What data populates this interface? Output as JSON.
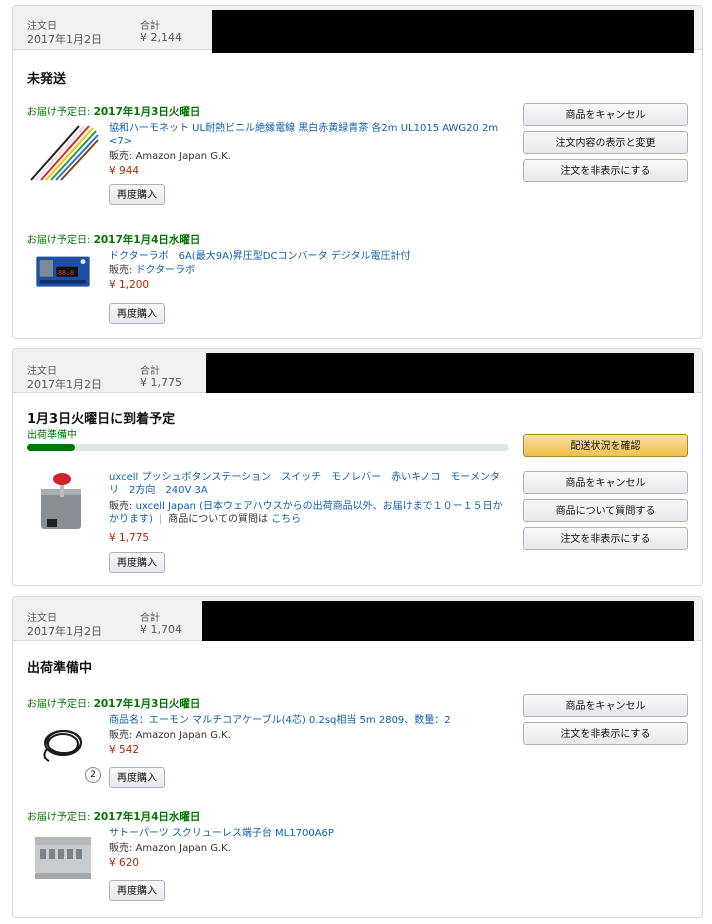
{
  "labels": {
    "order_date": "注文日",
    "total": "合計",
    "rebuy": "再度購入",
    "delivery_prefix": "お届け予定日: ",
    "seller_prefix": "販売: "
  },
  "orders": [
    {
      "date": "2017年1月2日",
      "total": "¥ 2,144",
      "status": "未発送",
      "buttons": [
        "商品をキャンセル",
        "注文内容の表示と変更",
        "注文を非表示にする"
      ],
      "shipments": [
        {
          "delivery_date": "2017年1月3日火曜日",
          "item": {
            "title_line1": "協和ハーモネット UL耐熱ビニル絶縁電線 黒白赤黄緑青茶 各2m UL1015 AWG20 2m",
            "title_line2": "<7>",
            "seller": "Amazon Japan G.K.",
            "price": "¥ 944",
            "image": "colored-wires-image"
          }
        },
        {
          "delivery_date": "2017年1月4日水曜日",
          "item": {
            "title_line1": "ドクターラボ　6A(最大9A)昇圧型DCコンバータ デジタル電圧計付",
            "seller": "ドクターラボ",
            "price": "¥ 1,200",
            "image": "dc-converter-board-image"
          }
        }
      ]
    },
    {
      "date": "2017年1月2日",
      "total": "¥ 1,775",
      "status": "1月3日火曜日に到着予定",
      "sub_status": "出荷準備中",
      "progress": 0.1,
      "primary_button": "配送状況を確認",
      "buttons": [
        "商品をキャンセル",
        "商品について質問する",
        "注文を非表示にする"
      ],
      "item": {
        "title_line1": "uxcell プッシュボタンステーション　スイッチ　モノレバー　赤いキノコ　モーメンタ",
        "title_line2": "リ　2方向　240V 3A",
        "seller_line1": "uxcell Japan (日本ウェアハウスからの出荷商品以外、お届けまで１０ー１５日か",
        "seller_line2": "かります)",
        "question_text": "商品についての質問は",
        "question_link": "こちら",
        "price": "¥ 1,775",
        "image": "push-button-station-image"
      }
    },
    {
      "date": "2017年1月2日",
      "total": "¥ 1,704",
      "status": "出荷準備中",
      "buttons": [
        "商品をキャンセル",
        "注文を非表示にする"
      ],
      "shipments": [
        {
          "delivery_date": "2017年1月3日火曜日",
          "item": {
            "title_line1": "商品名：エーモン マルチコアケーブル(4芯) 0.2sq相当 5m 2809、数量：2",
            "seller": "Amazon Japan G.K.",
            "price": "¥ 542",
            "quantity": "2",
            "image": "cable-coil-image"
          }
        },
        {
          "delivery_date": "2017年1月4日水曜日",
          "item": {
            "title_line1": "サトーパーツ スクリューレス端子台 ML1700A6P",
            "seller": "Amazon Japan G.K.",
            "price": "¥ 620",
            "image": "terminal-block-image"
          }
        }
      ]
    }
  ]
}
